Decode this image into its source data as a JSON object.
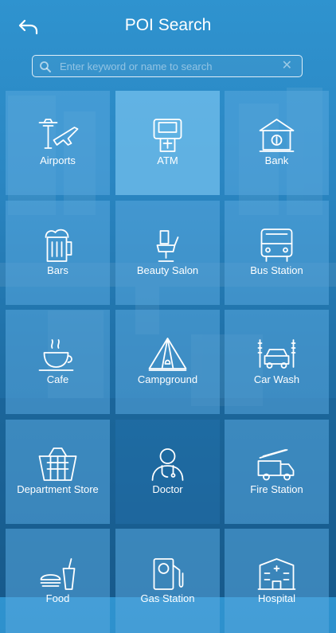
{
  "header": {
    "title": "POI Search"
  },
  "search": {
    "placeholder": "Enter keyword or name to search",
    "value": "",
    "clear_glyph": "✕"
  },
  "icons": {
    "back": "back-arrow-icon",
    "search": "search-icon",
    "clear": "clear-icon"
  },
  "colors": {
    "accent": "#2f93cf",
    "tile": "#58a8de",
    "text": "#ffffff"
  },
  "categories": [
    {
      "label": "Airports",
      "icon": "airport-icon"
    },
    {
      "label": "ATM",
      "icon": "atm-icon"
    },
    {
      "label": "Bank",
      "icon": "bank-icon"
    },
    {
      "label": "Bars",
      "icon": "beer-icon"
    },
    {
      "label": "Beauty Salon",
      "icon": "salon-chair-icon"
    },
    {
      "label": "Bus Station",
      "icon": "bus-icon"
    },
    {
      "label": "Cafe",
      "icon": "coffee-cup-icon"
    },
    {
      "label": "Campground",
      "icon": "tent-icon"
    },
    {
      "label": "Car Wash",
      "icon": "car-wash-icon"
    },
    {
      "label": "Department Store",
      "icon": "basket-icon"
    },
    {
      "label": "Doctor",
      "icon": "doctor-icon"
    },
    {
      "label": "Fire Station",
      "icon": "fire-truck-icon"
    },
    {
      "label": "Food",
      "icon": "food-icon"
    },
    {
      "label": "Gas Station",
      "icon": "fuel-pump-icon"
    },
    {
      "label": "Hospital",
      "icon": "hospital-icon"
    }
  ]
}
